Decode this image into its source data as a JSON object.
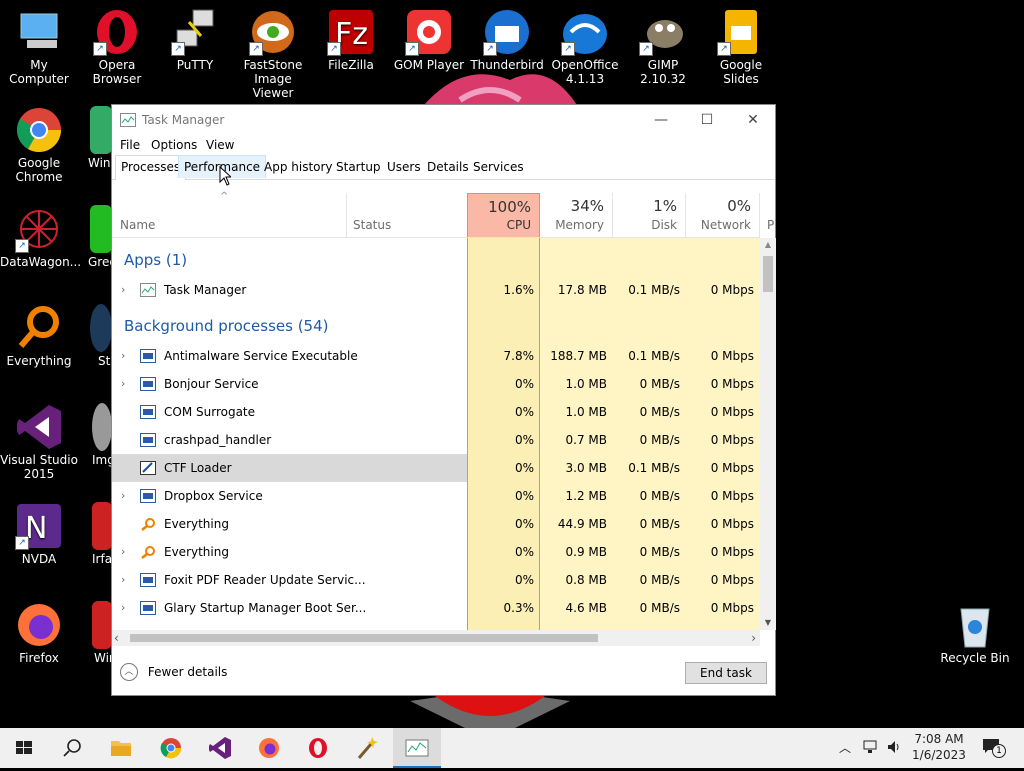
{
  "desktop": {
    "icons": [
      {
        "label": "My Computer"
      },
      {
        "label": "Opera Browser"
      },
      {
        "label": "PuTTY"
      },
      {
        "label": "FastStone Image Viewer"
      },
      {
        "label": "FileZilla"
      },
      {
        "label": "GOM Player"
      },
      {
        "label": "Thunderbird"
      },
      {
        "label": "OpenOffice 4.1.13"
      },
      {
        "label": "GIMP 2.10.32"
      },
      {
        "label": "Google Slides"
      },
      {
        "label": "Google Chrome"
      },
      {
        "label": "Win"
      },
      {
        "label": "DataWagon..."
      },
      {
        "label": "Gree"
      },
      {
        "label": "Everything"
      },
      {
        "label": "St"
      },
      {
        "label": "Visual Studio 2015"
      },
      {
        "label": "Img"
      },
      {
        "label": "NVDA"
      },
      {
        "label": "Irfan"
      },
      {
        "label": "Firefox"
      },
      {
        "label": "Win"
      },
      {
        "label": "Recycle Bin"
      }
    ]
  },
  "window": {
    "title": "Task Manager",
    "menu": [
      "File",
      "Options",
      "View"
    ],
    "tabs": [
      "Processes",
      "Performance",
      "App history",
      "Startup",
      "Users",
      "Details",
      "Services"
    ],
    "active_tab": "Processes",
    "columns": {
      "name": "Name",
      "status": "Status",
      "cpu": {
        "pct": "100%",
        "label": "CPU"
      },
      "memory": {
        "pct": "34%",
        "label": "Memory"
      },
      "disk": {
        "pct": "1%",
        "label": "Disk"
      },
      "network": {
        "pct": "0%",
        "label": "Network"
      },
      "power": "P"
    },
    "apps_group": "Apps (1)",
    "apps": [
      {
        "name": "Task Manager",
        "cpu": "1.6%",
        "memory": "17.8 MB",
        "disk": "0.1 MB/s",
        "network": "0 Mbps"
      }
    ],
    "bg_group": "Background processes (54)",
    "processes": [
      {
        "name": "Antimalware Service Executable",
        "cpu": "7.8%",
        "memory": "188.7 MB",
        "disk": "0.1 MB/s",
        "network": "0 Mbps"
      },
      {
        "name": "Bonjour Service",
        "cpu": "0%",
        "memory": "1.0 MB",
        "disk": "0 MB/s",
        "network": "0 Mbps"
      },
      {
        "name": "COM Surrogate",
        "cpu": "0%",
        "memory": "1.0 MB",
        "disk": "0 MB/s",
        "network": "0 Mbps"
      },
      {
        "name": "crashpad_handler",
        "cpu": "0%",
        "memory": "0.7 MB",
        "disk": "0 MB/s",
        "network": "0 Mbps"
      },
      {
        "name": "CTF Loader",
        "cpu": "0%",
        "memory": "3.0 MB",
        "disk": "0.1 MB/s",
        "network": "0 Mbps"
      },
      {
        "name": "Dropbox Service",
        "cpu": "0%",
        "memory": "1.2 MB",
        "disk": "0 MB/s",
        "network": "0 Mbps"
      },
      {
        "name": "Everything",
        "cpu": "0%",
        "memory": "44.9 MB",
        "disk": "0 MB/s",
        "network": "0 Mbps"
      },
      {
        "name": "Everything",
        "cpu": "0%",
        "memory": "0.9 MB",
        "disk": "0 MB/s",
        "network": "0 Mbps"
      },
      {
        "name": "Foxit PDF Reader Update Servic...",
        "cpu": "0%",
        "memory": "0.8 MB",
        "disk": "0 MB/s",
        "network": "0 Mbps"
      },
      {
        "name": "Glary Startup Manager Boot Ser...",
        "cpu": "0.3%",
        "memory": "4.6 MB",
        "disk": "0 MB/s",
        "network": "0 Mbps"
      }
    ],
    "fewer_details": "Fewer details",
    "end_task": "End task"
  },
  "taskbar": {
    "time": "7:08 AM",
    "date": "1/6/2023",
    "notification_count": "1"
  },
  "colors": {
    "cpu_header": "#f9b9a6",
    "cpu_heat": "#fcefb5",
    "heat_light": "#fff4c4",
    "heat_lighter": "#fffae0",
    "group_text": "#1f5aa8"
  }
}
